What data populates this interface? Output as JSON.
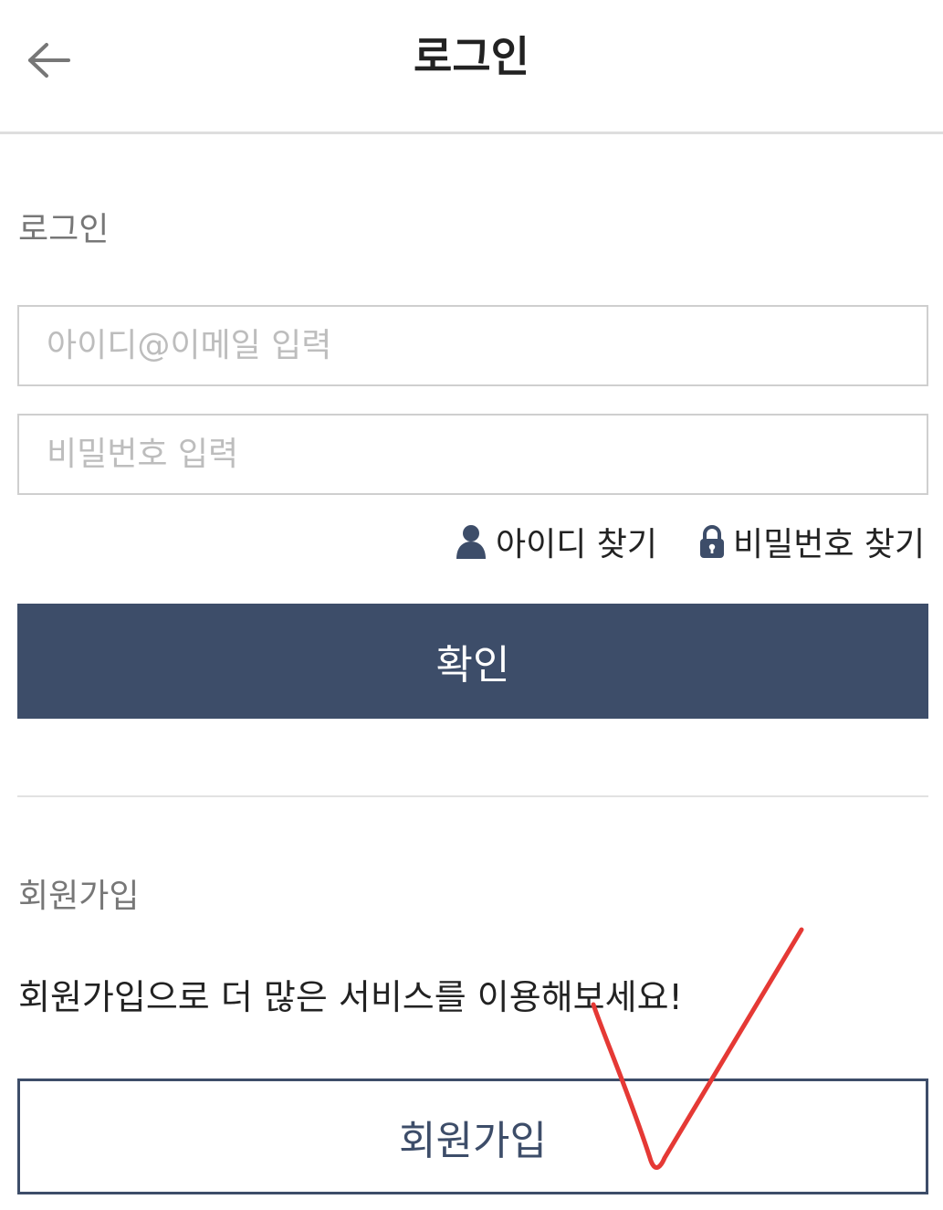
{
  "header": {
    "title": "로그인",
    "back_icon": "arrow-left-icon"
  },
  "login_section": {
    "label": "로그인",
    "id_placeholder": "아이디@이메일 입력",
    "id_value": "",
    "password_placeholder": "비밀번호 입력",
    "password_value": "",
    "find_id_label": "아이디 찾기",
    "find_id_icon": "user-icon",
    "find_password_label": "비밀번호 찾기",
    "find_password_icon": "lock-icon",
    "confirm_label": "확인"
  },
  "signup_section": {
    "label": "회원가입",
    "promo_text": "회원가입으로 더 많은 서비스를 이용해보세요!",
    "signup_label": "회원가입"
  },
  "colors": {
    "primary": "#3d4d69",
    "annotation": "#e53935",
    "placeholder": "#bdbdbd",
    "section_label": "#777777"
  }
}
